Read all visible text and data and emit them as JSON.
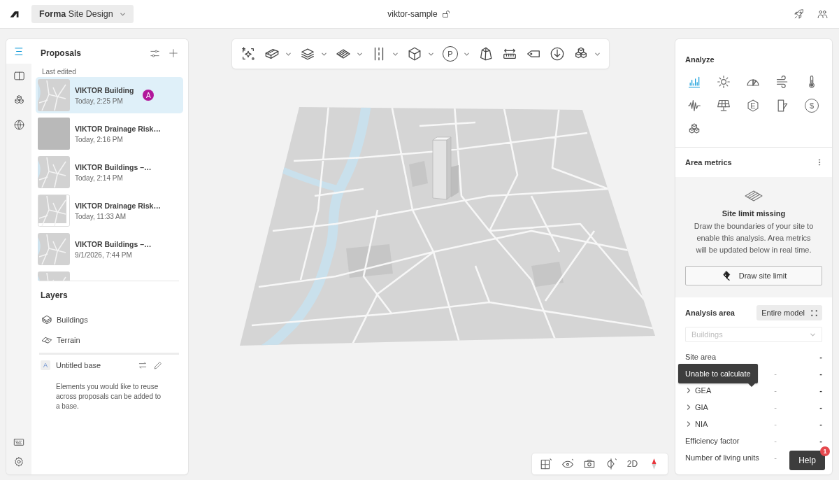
{
  "top_bar": {
    "product_menu": "**Forma** Site Design",
    "project_title": "viktor-sample",
    "locked": false,
    "actions": [
      {
        "kind": "rocket"
      },
      {
        "kind": "people"
      }
    ]
  },
  "left_panel": {
    "rail": [
      {
        "kind": "proposals",
        "selected": true
      },
      {
        "kind": "library",
        "selected": false
      },
      {
        "kind": "extensions",
        "selected": false
      },
      {
        "kind": "globe",
        "selected": false
      }
    ],
    "rail_bottom": [
      {
        "kind": "keyboard"
      },
      {
        "kind": "settings"
      }
    ],
    "proposals": {
      "title": "Proposals",
      "section_label": "Last edited",
      "items": [
        {
          "kind": "map",
          "name": "VIKTOR Building",
          "time": "Today, 2:25 PM",
          "badge": "A",
          "selected": true
        },
        {
          "kind": "blank",
          "name": "VIKTOR Drainage Risk…",
          "time": "Today, 2:16 PM",
          "selected": false
        },
        {
          "kind": "map",
          "name": "VIKTOR Buildings –…",
          "time": "Today, 2:14 PM",
          "selected": false
        },
        {
          "kind": "framed-map",
          "name": "VIKTOR Drainage Risk…",
          "time": "Today, 11:33 AM",
          "selected": false
        },
        {
          "kind": "map",
          "name": "VIKTOR Buildings –…",
          "time": "9/1/2026, 7:44 PM",
          "selected": false
        },
        {
          "kind": "map",
          "selected": false
        }
      ]
    },
    "layers": {
      "title": "Layers",
      "items": [
        {
          "kind": "buildings",
          "label": "Buildings"
        },
        {
          "kind": "terrain",
          "label": "Terrain"
        }
      ]
    },
    "base": {
      "badge": "A",
      "name": "Untitled base",
      "description": "Elements you would like to reuse across proposals can be added to a base."
    }
  },
  "toolbar": {
    "tools": [
      {
        "kind": "ai-select",
        "menu": false
      },
      {
        "kind": "wall",
        "menu": true
      },
      {
        "kind": "floors",
        "menu": true
      },
      {
        "kind": "surface",
        "menu": true
      },
      {
        "kind": "road",
        "menu": true
      },
      {
        "kind": "volume",
        "menu": true
      },
      {
        "kind": "parking",
        "glyph": "P",
        "menu": true
      },
      {
        "kind": "shape",
        "menu": false
      },
      {
        "kind": "measure",
        "menu": false
      },
      {
        "kind": "tag",
        "menu": false
      },
      {
        "kind": "import",
        "menu": false
      },
      {
        "kind": "cubes",
        "menu": true
      }
    ]
  },
  "right_panel": {
    "analyze": {
      "title": "Analyze",
      "tools": [
        {
          "kind": "bars",
          "selected": true
        },
        {
          "kind": "sun",
          "selected": false
        },
        {
          "kind": "daylight",
          "selected": false
        },
        {
          "kind": "wind",
          "selected": false
        },
        {
          "kind": "thermometer",
          "selected": false
        },
        {
          "kind": "noise",
          "selected": false
        },
        {
          "kind": "solar-panel",
          "selected": false
        },
        {
          "kind": "energy",
          "glyph": "E",
          "selected": false
        },
        {
          "kind": "facade",
          "selected": false
        },
        {
          "kind": "cost",
          "glyph": "$",
          "selected": false
        },
        {
          "kind": "cubes",
          "selected": false
        }
      ]
    },
    "area_metrics": {
      "title": "Area metrics",
      "notice": {
        "title": "Site limit missing",
        "text": "Draw the boundaries of your site to enable this analysis. Area metrics will be updated below in real time.",
        "button": "Draw site limit"
      },
      "analysis_area": {
        "label": "Analysis area",
        "scope_button": "Entire model"
      },
      "dropdown": {
        "value": "Buildings",
        "disabled": true
      },
      "rows": [
        {
          "label": "Site area",
          "expandable": false,
          "column_3": "-"
        },
        {
          "column_2": "-",
          "column_3": "-"
        },
        {
          "label": "GEA",
          "expandable": true,
          "column_2": "-",
          "column_3": "-"
        },
        {
          "label": "GIA",
          "expandable": true,
          "column_2": "-",
          "column_3": "-"
        },
        {
          "label": "NIA",
          "expandable": true,
          "column_2": "-",
          "column_3": "-"
        },
        {
          "label": "Efficiency factor",
          "expandable": false,
          "column_2": "-",
          "column_3": "-"
        },
        {
          "label": "Number of living units",
          "expandable": false,
          "column_2": "-"
        }
      ],
      "tooltip": "Unable to calculate"
    }
  },
  "view_bar": {
    "tools": [
      {
        "kind": "grid"
      },
      {
        "kind": "eye"
      },
      {
        "kind": "camera"
      },
      {
        "kind": "section"
      },
      {
        "kind": "mode",
        "label": "2D"
      },
      {
        "kind": "compass"
      }
    ]
  },
  "help": {
    "label": "Help",
    "badge": "1"
  }
}
